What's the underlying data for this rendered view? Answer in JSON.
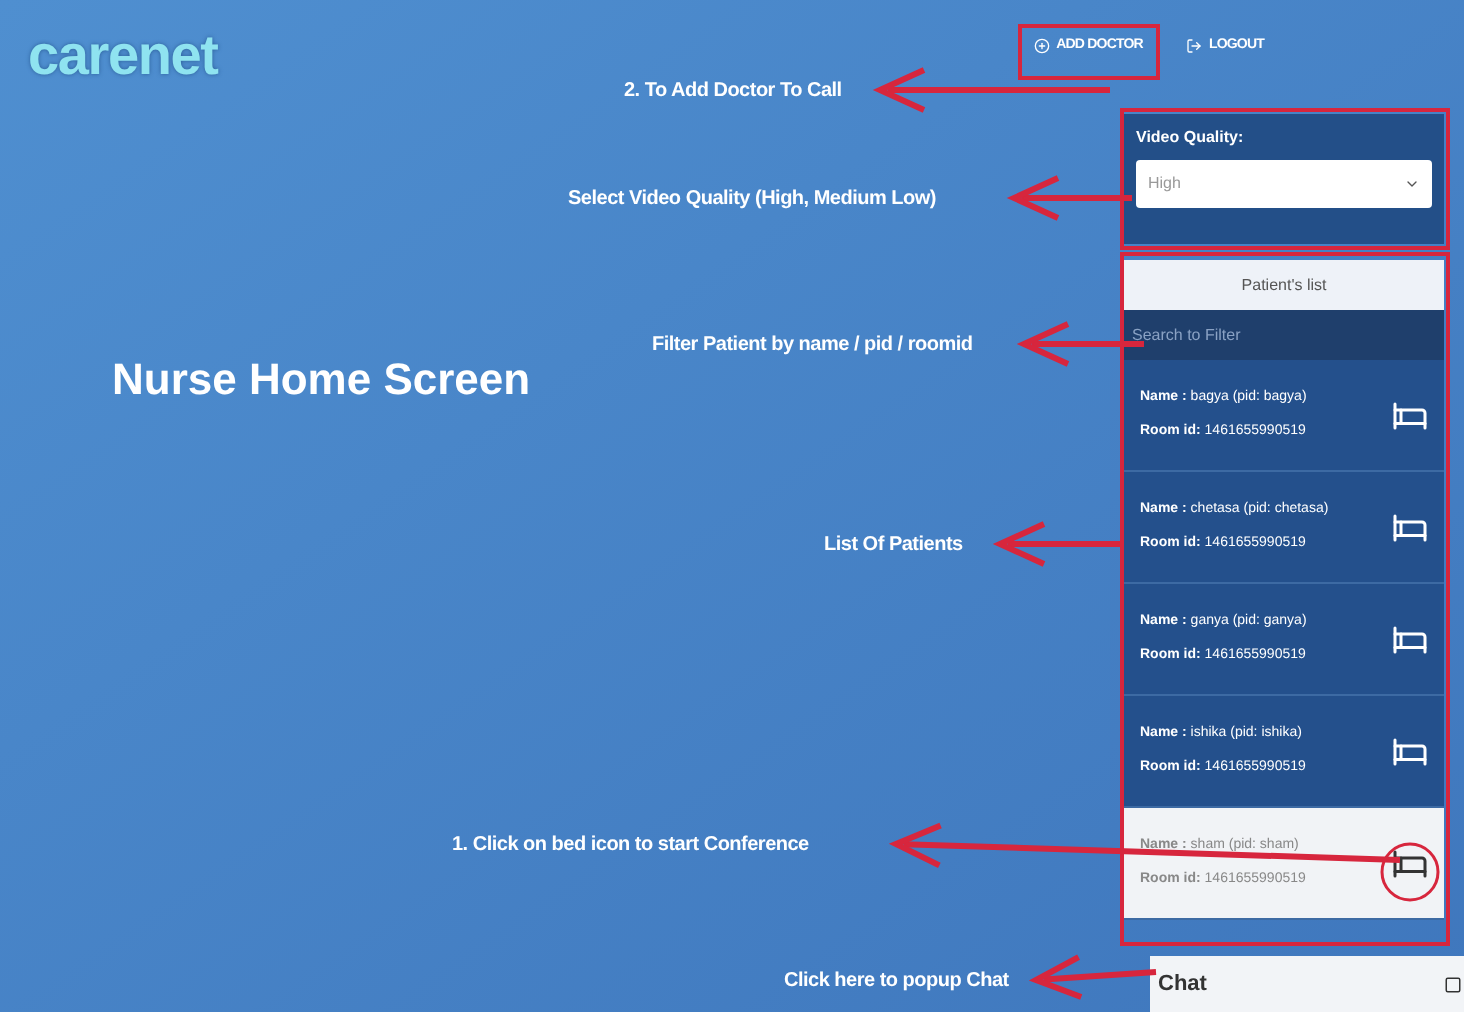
{
  "header": {
    "logo": "carenet",
    "links": [
      {
        "label": "ADD DOCTOR",
        "kind": "add"
      },
      {
        "label": "LOGOUT",
        "kind": "logout"
      }
    ]
  },
  "heading": "Nurse Home Screen",
  "video_quality": {
    "label": "Video Quality:",
    "value": "High"
  },
  "patients": {
    "title": "Patient's list",
    "search_placeholder": "Search to Filter",
    "items": [
      {
        "name_label": "Name :",
        "name": "bagya (pid: bagya)",
        "room_label": "Room id:",
        "room": "1461655990519",
        "selected": false
      },
      {
        "name_label": "Name :",
        "name": "chetasa (pid: chetasa)",
        "room_label": "Room id:",
        "room": "1461655990519",
        "selected": false
      },
      {
        "name_label": "Name :",
        "name": "ganya (pid: ganya)",
        "room_label": "Room id:",
        "room": "1461655990519",
        "selected": false
      },
      {
        "name_label": "Name :",
        "name": "ishika (pid: ishika)",
        "room_label": "Room id:",
        "room": "1461655990519",
        "selected": false
      },
      {
        "name_label": "Name :",
        "name": "sham (pid: sham)",
        "room_label": "Room id:",
        "room": "1461655990519",
        "selected": true
      }
    ]
  },
  "chat": {
    "label": "Chat"
  },
  "annotations": [
    {
      "text": "2. To Add Doctor To Call"
    },
    {
      "text": "Select Video Quality (High, Medium Low)"
    },
    {
      "text": "Filter Patient by name / pid / roomid"
    },
    {
      "text": "List Of Patients"
    },
    {
      "text": "1. Click on bed icon to start Conference"
    },
    {
      "text": "Click here to popup Chat"
    }
  ]
}
